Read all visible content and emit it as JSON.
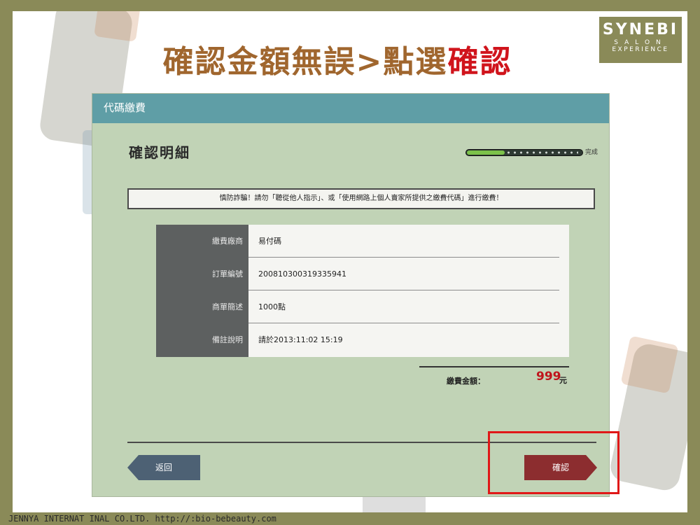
{
  "slide": {
    "title_part1": "確認金額無誤>點選",
    "title_part2": "確認",
    "footer": "JENNYA INTERNAT INAL CO.LTD.  http://:bio-bebeauty.com",
    "logo": {
      "brand": "SYNEBI",
      "line1": "SALON",
      "line2": "EXPERIENCE"
    }
  },
  "app": {
    "header_title": "代碼繳費",
    "page_heading": "確認明細",
    "progress": {
      "label": "完成",
      "fraction": 0.33
    },
    "notice": "慎防詐騙！請勿「聽從他人指示」、或「使用網路上個人賣家所提供之繳費代碼」進行繳費！",
    "details": [
      {
        "label": "繳費廠商",
        "value": "易付碼"
      },
      {
        "label": "訂單編號",
        "value": "2008103003193359​41"
      },
      {
        "label": "商單簡述",
        "value": "1000點"
      },
      {
        "label": "備註說明",
        "value": "請於2013:11:02 15:19"
      }
    ],
    "total": {
      "label": "繳費金額：",
      "amount": "999",
      "unit": "元"
    },
    "buttons": {
      "back": "返回",
      "confirm": "確認"
    }
  },
  "colors": {
    "title": "#a0662e",
    "title_highlight": "#d0141c",
    "header": "#5f9ea6",
    "panel": "#c1d3b6",
    "back_button": "#4d6174",
    "confirm_button": "#8c2d2f",
    "highlight_box": "#e01818"
  }
}
